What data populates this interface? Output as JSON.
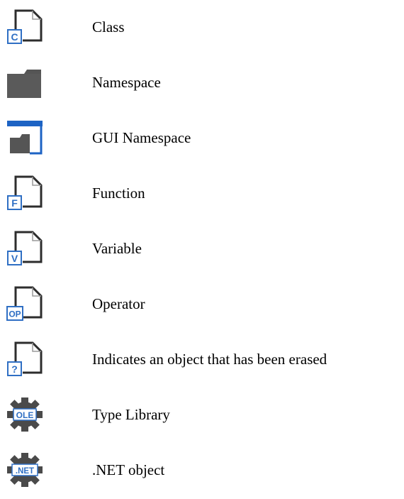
{
  "legend": {
    "items": [
      {
        "icon": "class-icon",
        "badge": "C",
        "label": "Class"
      },
      {
        "icon": "namespace-icon",
        "label": "Namespace"
      },
      {
        "icon": "gui-namespace-icon",
        "label": "GUI Namespace"
      },
      {
        "icon": "function-icon",
        "badge": "F",
        "label": "Function"
      },
      {
        "icon": "variable-icon",
        "badge": "V",
        "label": "Variable"
      },
      {
        "icon": "operator-icon",
        "badge": "OP",
        "label": "Operator"
      },
      {
        "icon": "erased-object-icon",
        "badge": "?",
        "label": "Indicates an object that has been erased"
      },
      {
        "icon": "type-library-icon",
        "badge": "OLE",
        "label": "Type Library"
      },
      {
        "icon": "dotnet-object-icon",
        "badge": ".NET",
        "label": ".NET object"
      }
    ]
  },
  "colors": {
    "page_stroke": "#2d2d2d",
    "badge_blue": "#2f6fc4",
    "folder_gray": "#555555",
    "gear_gray": "#4a4a4a",
    "gui_blue": "#1d63c4"
  }
}
